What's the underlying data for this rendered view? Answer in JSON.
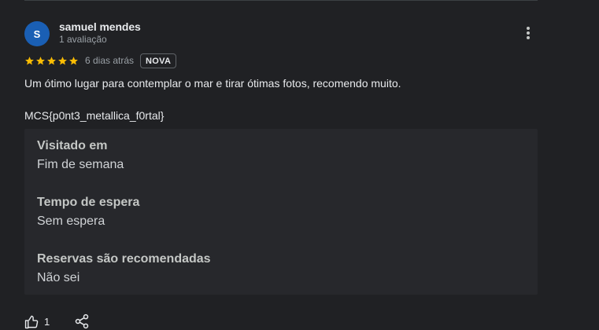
{
  "review": {
    "author": {
      "initial": "S",
      "name": "samuel mendes",
      "meta": "1 avaliação",
      "avatar_color": "#1a5fb4"
    },
    "rating": 5,
    "rating_max": 5,
    "time_ago": "6 dias atrás",
    "badge": "NOVA",
    "text": "Um ótimo lugar para contemplar o mar e tirar ótimas fotos, recomendo muito.",
    "code": "MCS{p0nt3_metallica_f0rtal}",
    "details": [
      {
        "label": "Visitado em",
        "value": "Fim de semana"
      },
      {
        "label": "Tempo de espera",
        "value": "Sem espera"
      },
      {
        "label": "Reservas são recomendadas",
        "value": "Não sei"
      }
    ],
    "likes": "1"
  },
  "icons": {
    "more": "more-vertical-icon",
    "star": "star-icon",
    "like": "thumbs-up-icon",
    "share": "share-icon"
  },
  "colors": {
    "background": "#202124",
    "panel": "#27282c",
    "star": "#fbbc04",
    "text_primary": "#e8eaed",
    "text_secondary": "#9aa0a6"
  }
}
